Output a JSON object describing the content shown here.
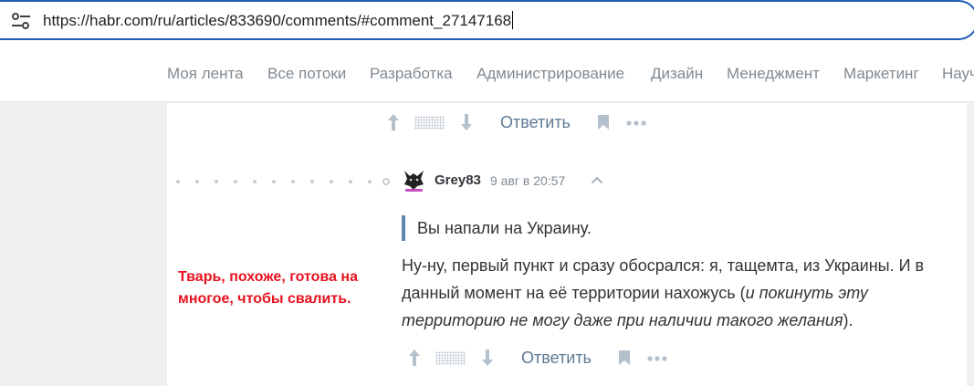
{
  "browser": {
    "url": "https://habr.com/ru/articles/833690/comments/#comment_27147168",
    "site_info_icon": "tune-icon"
  },
  "nav": {
    "items": [
      "Моя лента",
      "Все потоки",
      "Разработка",
      "Администрирование",
      "Дизайн",
      "Менеджмент",
      "Маркетинг",
      "Науч"
    ]
  },
  "parent_actions": {
    "reply_label": "Ответить"
  },
  "comment": {
    "author": "Grey83",
    "time": "9 авг в 20:57",
    "quote": "Вы напали на Украину.",
    "text_part1": "Ну-ну, первый пункт и сразу обосрался: я, тащемта, из Украины. И в данный момент на её территории нахожусь (",
    "text_italic": "и покинуть эту территорию не могу даже при наличии такого желания",
    "text_part2": ").",
    "reply_label": "Ответить"
  },
  "annotation": {
    "line1": "Тварь, похоже, готова на",
    "line2": "многое, чтобы свалить."
  },
  "colors": {
    "accent_blue": "#1f5fb5",
    "link": "#5e7894",
    "quote_bar": "#5e89ad",
    "annotation_red": "#e8121f"
  }
}
